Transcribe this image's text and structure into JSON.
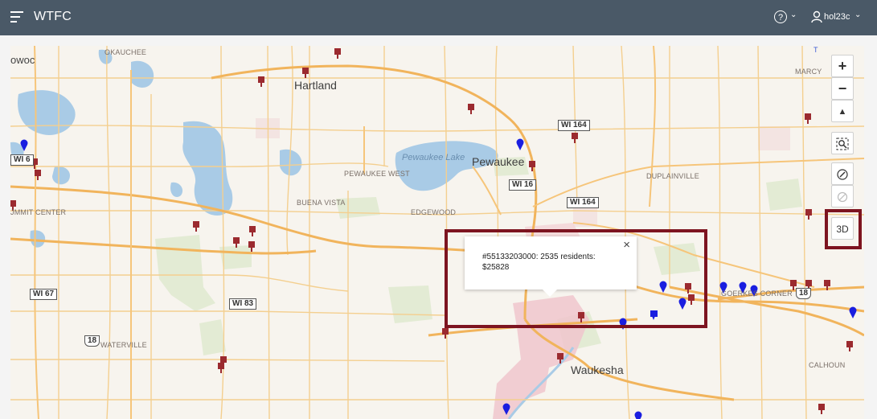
{
  "header": {
    "app_title": "WTFC",
    "help_label": "?",
    "user_name": "hol23c"
  },
  "map": {
    "places": {
      "hartland": "Hartland",
      "pewaukee": "Pewaukee",
      "waukesha": "Waukesha",
      "pewaukee_lake": "Pewaukee Lake",
      "okauchee": "OKAUCHEE",
      "marcy": "MARCY",
      "pewaukee_west": "PEWAUKEE WEST",
      "duplainville": "DUPLAINVILLE",
      "buena_vista": "BUENA VISTA",
      "edgewood": "EDGEWOOD",
      "summit_center": "JMMIT CENTER",
      "goerkes_corner": "GOERKES CORNER",
      "waterville": "WATERVILLE",
      "calhoun": "CALHOUN",
      "oconomowoc_partial": "owoc",
      "t_marker": "T"
    },
    "highways": {
      "wi164_a": "WI 164",
      "wi16": "WI 16",
      "wi164_b": "WI 164",
      "wi67": "WI 67",
      "wi83": "WI 83",
      "wi_left": "WI 6",
      "us18_a": "18",
      "us18_b": "18"
    },
    "accent_marker_red": "#9b2a2f",
    "accent_marker_blue": "#1a1ee0",
    "highlight_color": "#7d1420"
  },
  "controls": {
    "zoom_in": "+",
    "zoom_out": "−",
    "compass": "▲",
    "three_d": "3D"
  },
  "popup": {
    "text": "#55133203000: 2535 residents: $25828",
    "close": "×"
  }
}
